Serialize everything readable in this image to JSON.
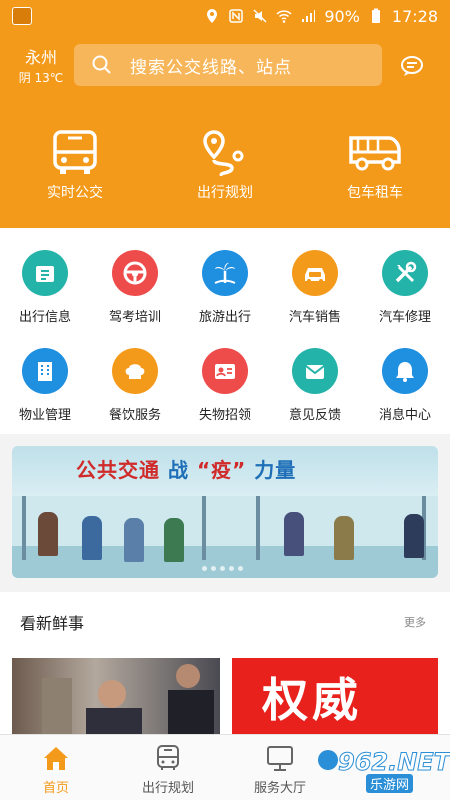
{
  "status_bar": {
    "battery": "90%",
    "time": "17:28"
  },
  "header": {
    "city": "永州",
    "weather": "阴 13℃",
    "search_placeholder": "搜索公交线路、站点"
  },
  "top_nav": [
    {
      "label": "实时公交",
      "icon": "bus-icon"
    },
    {
      "label": "出行规划",
      "icon": "route-icon"
    },
    {
      "label": "包车租车",
      "icon": "coach-icon"
    }
  ],
  "services": [
    {
      "label": "出行信息",
      "icon": "info-board-icon",
      "color": "#23b3a8"
    },
    {
      "label": "驾考培训",
      "icon": "steering-wheel-icon",
      "color": "#ee4b4b"
    },
    {
      "label": "旅游出行",
      "icon": "palm-tree-icon",
      "color": "#1f8fe0"
    },
    {
      "label": "汽车销售",
      "icon": "car-sale-icon",
      "color": "#f49a1b"
    },
    {
      "label": "汽车修理",
      "icon": "wrench-icon",
      "color": "#23b3a8"
    },
    {
      "label": "物业管理",
      "icon": "building-icon",
      "color": "#1f8fe0"
    },
    {
      "label": "餐饮服务",
      "icon": "chef-hat-icon",
      "color": "#f49a1b"
    },
    {
      "label": "失物招领",
      "icon": "id-card-icon",
      "color": "#ee4b4b"
    },
    {
      "label": "意见反馈",
      "icon": "envelope-icon",
      "color": "#23b3a8"
    },
    {
      "label": "消息中心",
      "icon": "bell-icon",
      "color": "#1f8fe0"
    }
  ],
  "banner": {
    "title_a": "公共交通",
    "title_b": "战",
    "title_c": "“疫”",
    "title_d": "力量"
  },
  "news": {
    "title": "看新鲜事",
    "more": "更多",
    "image2_text": "权威"
  },
  "tab_bar": [
    {
      "label": "首页",
      "icon": "home-icon",
      "active": true
    },
    {
      "label": "出行规划",
      "icon": "bus-front-icon",
      "active": false
    },
    {
      "label": "服务大厅",
      "icon": "monitor-icon",
      "active": false
    }
  ],
  "watermark": {
    "number": "962.NET",
    "sub": "乐游网"
  },
  "colors": {
    "brand": "#f49a1b"
  }
}
